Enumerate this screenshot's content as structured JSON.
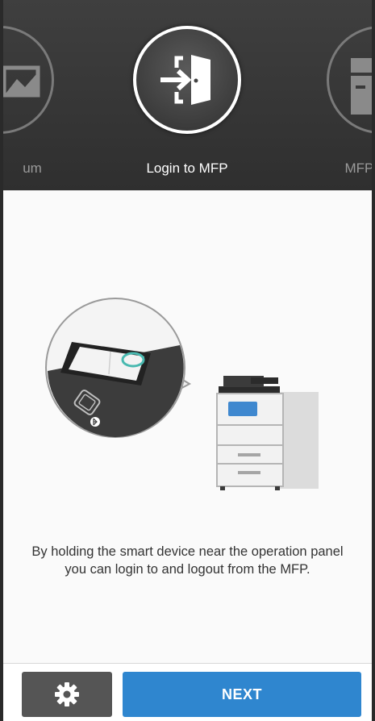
{
  "carousel": {
    "items": [
      {
        "label": "um",
        "icon": "image-album-icon"
      },
      {
        "label": "Login to MFP",
        "icon": "login-door-icon"
      },
      {
        "label": "MFP /",
        "icon": "mfp-device-icon"
      }
    ]
  },
  "content": {
    "description_line1": "By holding the smart device near the operation panel",
    "description_line2": "you can login to and logout from the MFP."
  },
  "footer": {
    "settings_icon": "gear-icon",
    "next_label": "NEXT"
  },
  "colors": {
    "header_bg": "#333333",
    "accent_blue": "#2f86cf",
    "settings_btn": "#555555"
  }
}
